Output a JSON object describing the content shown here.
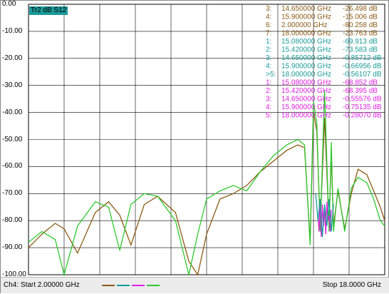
{
  "trace_tag": "Tr2 dB S12",
  "y_axis": {
    "labels": [
      "0.00",
      "-10.00",
      "-20.00",
      "-30.00",
      "-40.00",
      "-50.00",
      "-60.00",
      "-70.00",
      "-80.00",
      "-90.00",
      "-100.00"
    ],
    "ylim": [
      -100,
      0
    ],
    "divisions": 10
  },
  "status": {
    "start": "Ch4: Start  2.00000 GHz",
    "stop": "Stop  18.0000 GHz"
  },
  "colors": {
    "brown": "#8b5a14",
    "teal": "#1a9a9a",
    "green": "#2ec82e",
    "magenta": "#e020e0"
  },
  "markers": [
    {
      "id": "3:",
      "freq": "14.650000 GHz",
      "val": "-26.498 dB",
      "color": "#8b5a14"
    },
    {
      "id": "4:",
      "freq": "15.900000 GHz",
      "val": "-15.006 dB",
      "color": "#8b5a14"
    },
    {
      "id": "6:",
      "freq": "2.000000 GHz",
      "val": "-80.258 dB",
      "color": "#8b5a14"
    },
    {
      "id": "7:",
      "freq": "18.000000 GHz",
      "val": "-23.763 dB",
      "color": "#8b5a14"
    },
    {
      "id": "1:",
      "freq": "15.080000 GHz",
      "val": "-69.913 dB",
      "color": "#1a9a9a"
    },
    {
      "id": "2:",
      "freq": "15.420000 GHz",
      "val": "-73.583 dB",
      "color": "#1a9a9a"
    },
    {
      "id": "3:",
      "freq": "14.650000 GHz",
      "val": "-0.85712 dB",
      "color": "#1a9a9a"
    },
    {
      "id": "4:",
      "freq": "15.900000 GHz",
      "val": "-0.66956 dB",
      "color": "#1a9a9a"
    },
    {
      "id": ">5:",
      "freq": "18.000000 GHz",
      "val": "-0.56107 dB",
      "color": "#1a9a9a"
    },
    {
      "id": "1:",
      "freq": "15.080000 GHz",
      "val": "-68.852 dB",
      "color": "#e020e0"
    },
    {
      "id": "2:",
      "freq": "15.420000 GHz",
      "val": "-68.395 dB",
      "color": "#e020e0"
    },
    {
      "id": "3:",
      "freq": "14.650000 GHz",
      "val": "-0.55576 dB",
      "color": "#e020e0"
    },
    {
      "id": "4:",
      "freq": "15.900000 GHz",
      "val": "-0.75135 dB",
      "color": "#e020e0"
    },
    {
      "id": "5:",
      "freq": "18.000000 GHz",
      "val": "-0.28070 dB",
      "color": "#e020e0"
    }
  ],
  "chart_data": {
    "type": "line",
    "xlabel": "",
    "ylabel": "",
    "xlim_ghz": [
      2,
      18
    ],
    "ylim": [
      -100,
      0
    ],
    "series": [
      {
        "color": "#8b5a14",
        "x": [
          2.0,
          2.6,
          3.2,
          3.6,
          4.2,
          5.0,
          5.6,
          6.1,
          6.6,
          7.2,
          7.8,
          8.6,
          9.2,
          9.6,
          10.0,
          10.6,
          11.2,
          11.8,
          12.4,
          13.0,
          13.6,
          14.1,
          14.4,
          14.65,
          14.8,
          14.95,
          15.1,
          15.3,
          15.5,
          15.6,
          15.7,
          15.9,
          16.2,
          16.5,
          16.8,
          17.2,
          17.5,
          17.8,
          18.0
        ],
        "y": [
          -90,
          -85,
          -81,
          -83,
          -92,
          -77,
          -73,
          -78,
          -89,
          -74,
          -71,
          -77,
          -95,
          -100,
          -85,
          -72,
          -70,
          -67,
          -62,
          -58,
          -54,
          -52,
          -53,
          -88,
          -40,
          -47,
          -82,
          -42,
          -82,
          -55,
          -82,
          -69,
          -83,
          -70,
          -61,
          -63,
          -69,
          -75,
          -80
        ]
      },
      {
        "color": "#2ec82e",
        "x": [
          2.0,
          2.6,
          3.2,
          3.6,
          4.2,
          5.0,
          5.6,
          6.1,
          6.6,
          7.2,
          7.8,
          8.6,
          9.2,
          9.6,
          10.0,
          10.6,
          11.2,
          11.8,
          12.4,
          13.0,
          13.6,
          14.1,
          14.4,
          14.65,
          14.8,
          14.95,
          15.1,
          15.3,
          15.5,
          15.6,
          15.7,
          15.9,
          16.2,
          16.5,
          16.8,
          17.2,
          17.5,
          17.8,
          18.0
        ],
        "y": [
          -88,
          -84,
          -87,
          -100,
          -82,
          -73,
          -75,
          -91,
          -74,
          -70,
          -71,
          -80,
          -100,
          -85,
          -72,
          -69,
          -67,
          -69,
          -62,
          -56,
          -52,
          -50,
          -52,
          -89,
          -36,
          -44,
          -84,
          -32,
          -84,
          -51,
          -84,
          -68,
          -84,
          -68,
          -64,
          -66,
          -72,
          -80,
          -82
        ]
      },
      {
        "color": "#e020e0",
        "x": [
          15.0,
          15.05,
          15.1,
          15.15,
          15.2,
          15.25,
          15.3,
          15.35,
          15.4,
          15.45,
          15.5,
          15.55,
          15.6
        ],
        "y": [
          -78,
          -84,
          -72,
          -86,
          -74,
          -82,
          -76,
          -85,
          -73,
          -80,
          -78,
          -84,
          -76
        ]
      },
      {
        "color": "#1a9a9a",
        "x": [
          14.9,
          15.0,
          15.1,
          15.2,
          15.3,
          15.4,
          15.5,
          15.6,
          15.7
        ],
        "y": [
          -70,
          -80,
          -72,
          -86,
          -74,
          -82,
          -72,
          -84,
          -74
        ]
      }
    ]
  }
}
